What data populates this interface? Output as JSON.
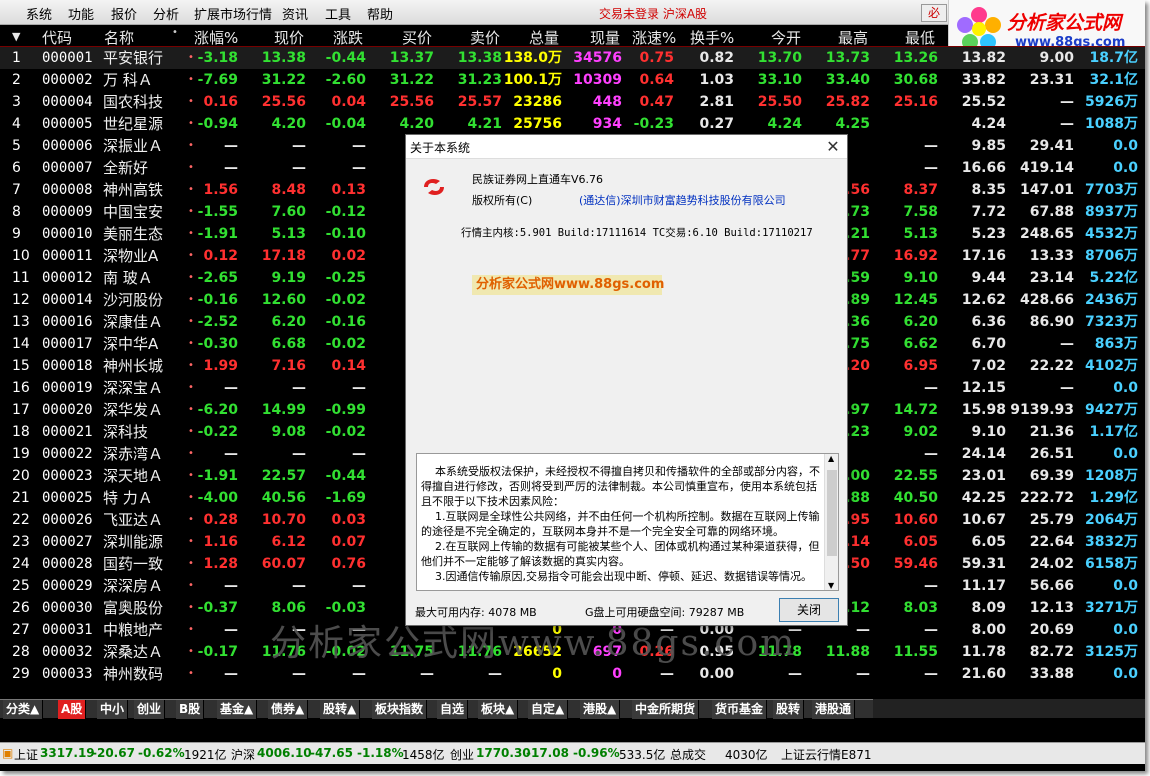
{
  "menubar": {
    "items": [
      "系统",
      "功能",
      "报价",
      "分析",
      "扩展市场行情",
      "资讯",
      "工具",
      "帮助"
    ],
    "login_status": "交易未登录 沪深A股",
    "bi_button": "必"
  },
  "logo": {
    "title": "分析家公式网",
    "url": "www.88gs.com"
  },
  "table": {
    "headers": [
      "代码",
      "名称",
      "涨幅%",
      "现价",
      "涨跌",
      "买价",
      "卖价",
      "总量",
      "现量",
      "涨速%",
      "换手%",
      "今开",
      "最高",
      "最低"
    ],
    "rows": [
      {
        "idx": "1",
        "code": "000001",
        "name": "平安银行",
        "chg": "-3.18",
        "price": "13.38",
        "diff": "-0.44",
        "buy": "13.37",
        "sell": "13.38",
        "vol": "138.0万",
        "cur": "34576",
        "spd": "0.75",
        "turn": "0.82",
        "open": "13.70",
        "high": "13.73",
        "low": "13.26",
        "c1": "13.82",
        "c2": "9.00",
        "c3": "18.7亿"
      },
      {
        "idx": "2",
        "code": "000002",
        "name": "万 科Ａ",
        "chg": "-7.69",
        "price": "31.22",
        "diff": "-2.60",
        "buy": "31.22",
        "sell": "31.23",
        "vol": "100.1万",
        "cur": "10309",
        "spd": "0.64",
        "turn": "1.03",
        "open": "33.10",
        "high": "33.40",
        "low": "30.68",
        "c1": "33.82",
        "c2": "23.31",
        "c3": "32.1亿"
      },
      {
        "idx": "3",
        "code": "000004",
        "name": "国农科技",
        "chg": "0.16",
        "price": "25.56",
        "diff": "0.04",
        "buy": "25.56",
        "sell": "25.57",
        "vol": "23286",
        "cur": "448",
        "spd": "0.47",
        "turn": "2.81",
        "open": "25.50",
        "high": "25.82",
        "low": "25.16",
        "c1": "25.52",
        "c2": "—",
        "c3": "5926万"
      },
      {
        "idx": "4",
        "code": "000005",
        "name": "世纪星源",
        "chg": "-0.94",
        "price": "4.20",
        "diff": "-0.04",
        "buy": "4.20",
        "sell": "4.21",
        "vol": "25756",
        "cur": "934",
        "spd": "-0.23",
        "turn": "0.27",
        "open": "4.24",
        "high": "4.25",
        "low": "",
        "c1": "4.24",
        "c2": "—",
        "c3": "1088万"
      },
      {
        "idx": "5",
        "code": "000006",
        "name": "深振业Ａ",
        "chg": "—",
        "price": "—",
        "diff": "—",
        "buy": "",
        "sell": "",
        "vol": "",
        "cur": "",
        "spd": "",
        "turn": "",
        "open": "",
        "high": "",
        "low": "—",
        "c1": "9.85",
        "c2": "29.41",
        "c3": "0.0"
      },
      {
        "idx": "6",
        "code": "000007",
        "name": "全新好",
        "chg": "—",
        "price": "—",
        "diff": "—",
        "buy": "",
        "sell": "",
        "vol": "",
        "cur": "",
        "spd": "",
        "turn": "",
        "open": "",
        "high": "",
        "low": "—",
        "c1": "16.66",
        "c2": "419.14",
        "c3": "0.0"
      },
      {
        "idx": "7",
        "code": "000008",
        "name": "神州高铁",
        "chg": "1.56",
        "price": "8.48",
        "diff": "0.13",
        "buy": "",
        "sell": "",
        "vol": "",
        "cur": "",
        "spd": "",
        "turn": "",
        "open": "",
        "high": ".56",
        "low": "8.37",
        "c1": "8.35",
        "c2": "147.01",
        "c3": "7703万"
      },
      {
        "idx": "8",
        "code": "000009",
        "name": "中国宝安",
        "chg": "-1.55",
        "price": "7.60",
        "diff": "-0.12",
        "buy": "",
        "sell": "",
        "vol": "",
        "cur": "",
        "spd": "",
        "turn": "",
        "open": "",
        "high": ".73",
        "low": "7.58",
        "c1": "7.72",
        "c2": "67.88",
        "c3": "8937万"
      },
      {
        "idx": "9",
        "code": "000010",
        "name": "美丽生态",
        "chg": "-1.91",
        "price": "5.13",
        "diff": "-0.10",
        "buy": "",
        "sell": "",
        "vol": "",
        "cur": "",
        "spd": "",
        "turn": "",
        "open": "",
        "high": ".21",
        "low": "5.13",
        "c1": "5.23",
        "c2": "248.65",
        "c3": "4532万"
      },
      {
        "idx": "10",
        "code": "000011",
        "name": "深物业A",
        "chg": "0.12",
        "price": "17.18",
        "diff": "0.02",
        "buy": "1",
        "sell": "",
        "vol": "",
        "cur": "",
        "spd": "",
        "turn": "",
        "open": "",
        "high": ".77",
        "low": "16.92",
        "c1": "17.16",
        "c2": "13.33",
        "c3": "8706万"
      },
      {
        "idx": "11",
        "code": "000012",
        "name": "南 玻Ａ",
        "chg": "-2.65",
        "price": "9.19",
        "diff": "-0.25",
        "buy": "",
        "sell": "",
        "vol": "",
        "cur": "",
        "spd": "",
        "turn": "",
        "open": "",
        "high": ".59",
        "low": "9.10",
        "c1": "9.44",
        "c2": "23.14",
        "c3": "5.22亿"
      },
      {
        "idx": "12",
        "code": "000014",
        "name": "沙河股份",
        "chg": "-0.16",
        "price": "12.60",
        "diff": "-0.02",
        "buy": "1",
        "sell": "",
        "vol": "",
        "cur": "",
        "spd": "",
        "turn": "",
        "open": "",
        "high": ".89",
        "low": "12.45",
        "c1": "12.62",
        "c2": "428.66",
        "c3": "2436万"
      },
      {
        "idx": "13",
        "code": "000016",
        "name": "深康佳Ａ",
        "chg": "-2.52",
        "price": "6.20",
        "diff": "-0.16",
        "buy": "",
        "sell": "",
        "vol": "",
        "cur": "",
        "spd": "",
        "turn": "",
        "open": "",
        "high": ".36",
        "low": "6.20",
        "c1": "6.36",
        "c2": "86.90",
        "c3": "7323万"
      },
      {
        "idx": "14",
        "code": "000017",
        "name": "深中华A",
        "chg": "-0.30",
        "price": "6.68",
        "diff": "-0.02",
        "buy": "",
        "sell": "",
        "vol": "",
        "cur": "",
        "spd": "",
        "turn": "",
        "open": "",
        "high": ".75",
        "low": "6.62",
        "c1": "6.70",
        "c2": "—",
        "c3": "863万"
      },
      {
        "idx": "15",
        "code": "000018",
        "name": "神州长城",
        "chg": "1.99",
        "price": "7.16",
        "diff": "0.14",
        "buy": "",
        "sell": "",
        "vol": "",
        "cur": "",
        "spd": "",
        "turn": "",
        "open": "",
        "high": ".20",
        "low": "6.95",
        "c1": "7.02",
        "c2": "22.22",
        "c3": "4102万"
      },
      {
        "idx": "16",
        "code": "000019",
        "name": "深深宝Ａ",
        "chg": "—",
        "price": "—",
        "diff": "—",
        "buy": "",
        "sell": "",
        "vol": "",
        "cur": "",
        "spd": "",
        "turn": "",
        "open": "",
        "high": "",
        "low": "—",
        "c1": "12.15",
        "c2": "—",
        "c3": "0.0"
      },
      {
        "idx": "17",
        "code": "000020",
        "name": "深华发Ａ",
        "chg": "-6.20",
        "price": "14.99",
        "diff": "-0.99",
        "buy": "1",
        "sell": "",
        "vol": "",
        "cur": "",
        "spd": "",
        "turn": "",
        "open": "",
        "high": ".97",
        "low": "14.72",
        "c1": "15.98",
        "c2": "9139.93",
        "c3": "9427万"
      },
      {
        "idx": "18",
        "code": "000021",
        "name": "深科技",
        "chg": "-0.22",
        "price": "9.08",
        "diff": "-0.02",
        "buy": "",
        "sell": "",
        "vol": "",
        "cur": "",
        "spd": "",
        "turn": "",
        "open": "",
        "high": ".23",
        "low": "9.02",
        "c1": "9.10",
        "c2": "21.36",
        "c3": "1.17亿"
      },
      {
        "idx": "19",
        "code": "000022",
        "name": "深赤湾Ａ",
        "chg": "—",
        "price": "—",
        "diff": "—",
        "buy": "",
        "sell": "",
        "vol": "",
        "cur": "",
        "spd": "",
        "turn": "",
        "open": "",
        "high": "",
        "low": "—",
        "c1": "24.14",
        "c2": "26.51",
        "c3": "0.0"
      },
      {
        "idx": "20",
        "code": "000023",
        "name": "深天地Ａ",
        "chg": "-1.91",
        "price": "22.57",
        "diff": "-0.44",
        "buy": "2",
        "sell": "",
        "vol": "",
        "cur": "",
        "spd": "",
        "turn": "",
        "open": "",
        "high": ".00",
        "low": "22.55",
        "c1": "23.01",
        "c2": "69.39",
        "c3": "1208万"
      },
      {
        "idx": "21",
        "code": "000025",
        "name": "特 力Ａ",
        "chg": "-4.00",
        "price": "40.56",
        "diff": "-1.69",
        "buy": "4",
        "sell": "",
        "vol": "",
        "cur": "",
        "spd": "",
        "turn": "",
        "open": "",
        "high": ".88",
        "low": "40.50",
        "c1": "42.25",
        "c2": "222.72",
        "c3": "1.29亿"
      },
      {
        "idx": "22",
        "code": "000026",
        "name": "飞亚达Ａ",
        "chg": "0.28",
        "price": "10.70",
        "diff": "0.03",
        "buy": "1",
        "sell": "",
        "vol": "",
        "cur": "",
        "spd": "",
        "turn": "",
        "open": "",
        "high": ".95",
        "low": "10.60",
        "c1": "10.67",
        "c2": "25.79",
        "c3": "2064万"
      },
      {
        "idx": "23",
        "code": "000027",
        "name": "深圳能源",
        "chg": "1.16",
        "price": "6.12",
        "diff": "0.07",
        "buy": "",
        "sell": "",
        "vol": "",
        "cur": "",
        "spd": "",
        "turn": "",
        "open": "",
        "high": ".14",
        "low": "6.05",
        "c1": "6.05",
        "c2": "22.64",
        "c3": "3832万"
      },
      {
        "idx": "24",
        "code": "000028",
        "name": "国药一致",
        "chg": "1.28",
        "price": "60.07",
        "diff": "0.76",
        "buy": "6",
        "sell": "",
        "vol": "",
        "cur": "",
        "spd": "",
        "turn": "",
        "open": "",
        "high": ".50",
        "low": "59.46",
        "c1": "59.31",
        "c2": "24.02",
        "c3": "6158万"
      },
      {
        "idx": "25",
        "code": "000029",
        "name": "深深房Ａ",
        "chg": "—",
        "price": "—",
        "diff": "—",
        "buy": "",
        "sell": "",
        "vol": "",
        "cur": "",
        "spd": "",
        "turn": "",
        "open": "",
        "high": "",
        "low": "—",
        "c1": "11.17",
        "c2": "56.66",
        "c3": "0.0"
      },
      {
        "idx": "26",
        "code": "000030",
        "name": "富奥股份",
        "chg": "-0.37",
        "price": "8.06",
        "diff": "-0.03",
        "buy": "",
        "sell": "",
        "vol": "",
        "cur": "",
        "spd": "",
        "turn": "",
        "open": "",
        "high": ".12",
        "low": "8.03",
        "c1": "8.09",
        "c2": "12.13",
        "c3": "3271万"
      },
      {
        "idx": "27",
        "code": "000031",
        "name": "中粮地产",
        "chg": "—",
        "price": "—",
        "diff": "—",
        "buy": "",
        "sell": "",
        "vol": "0",
        "cur": "0",
        "spd": "—",
        "turn": "0.00",
        "open": "—",
        "high": "—",
        "low": "—",
        "c1": "8.00",
        "c2": "20.69",
        "c3": "0.0"
      },
      {
        "idx": "28",
        "code": "000032",
        "name": "深桑达Ａ",
        "chg": "-0.17",
        "price": "11.76",
        "diff": "-0.02",
        "buy": "11.75",
        "sell": "11.76",
        "vol": "26652",
        "cur": "697",
        "spd": "0.26",
        "turn": "0.95",
        "open": "11.78",
        "high": "11.88",
        "low": "11.55",
        "c1": "11.78",
        "c2": "82.72",
        "c3": "3125万"
      },
      {
        "idx": "29",
        "code": "000033",
        "name": "神州数码",
        "chg": "—",
        "price": "—",
        "diff": "—",
        "buy": "—",
        "sell": "—",
        "vol": "0",
        "cur": "0",
        "spd": "—",
        "turn": "0.00",
        "open": "—",
        "high": "—",
        "low": "—",
        "c1": "21.60",
        "c2": "33.88",
        "c3": "0.0"
      }
    ]
  },
  "watermark": "分析家公式网www.88gs.com",
  "tabs": [
    "分类▲",
    "A股",
    "中小",
    "创业",
    "B股",
    "基金▲",
    "债券▲",
    "股转▲",
    "板块指数",
    "自选",
    "板块▲",
    "自定▲",
    "港股▲",
    "中金所期货",
    "货币基金",
    "股转",
    "港股通"
  ],
  "statusbar": {
    "sh_label": "上证",
    "sh_val": "3317.19",
    "sh_diff": "-20.67",
    "sh_pct": "-0.62%",
    "sh_amt": "1921亿",
    "hs_label": "沪深",
    "hs_val": "4006.10",
    "hs_diff": "-47.65",
    "hs_pct": "-1.18%",
    "hs_amt": "1458亿",
    "cy_label": "创业",
    "cy_val": "1770.30",
    "cy_diff": "-17.08",
    "cy_pct": "-0.96%",
    "cy_amt": "533.5亿",
    "total_label": "总成交",
    "total_val": "4030亿",
    "cloud": "上证云行情E871"
  },
  "dialog": {
    "title": "关于本系统",
    "product": "民族证券网上直通车V6.76",
    "copyright_label": "版权所有(C)",
    "company": "(通达信)深圳市财富趋势科技股份有限公司",
    "kernel": "行情主内核:5.901 Build:17111614 TC交易:6.10 Build:17110217",
    "watermark": "分析家公式网www.88gs.com",
    "license": "    本系统受版权法保护，未经授权不得擅自拷贝和传播软件的全部或部分内容，不得擅自进行修改，否则将受到严厉的法律制裁。本公司慎重宣布，使用本系统包括且不限于以下技术因素风险：\n    1.互联网是全球性公共网络，并不由任何一个机构所控制。数据在互联网上传输的途径是不完全确定的，互联网本身并不是一个完全安全可靠的网络环境。\n    2.在互联网上传输的数据有可能被某些个人、团体或机构通过某种渠道获得，但他们并不一定能够了解该数据的真实内容。\n    3.因通信传输原因,交易指令可能会出现中断、停顿、延迟、数据错误等情况。",
    "mem": "最大可用内存: 4078 MB",
    "disk": "G盘上可用硬盘空间: 79287 MB",
    "close": "关闭"
  },
  "colors": {
    "up": "#ff3030",
    "down": "#32e032",
    "volume": "#ffff00",
    "background": "#000000"
  }
}
